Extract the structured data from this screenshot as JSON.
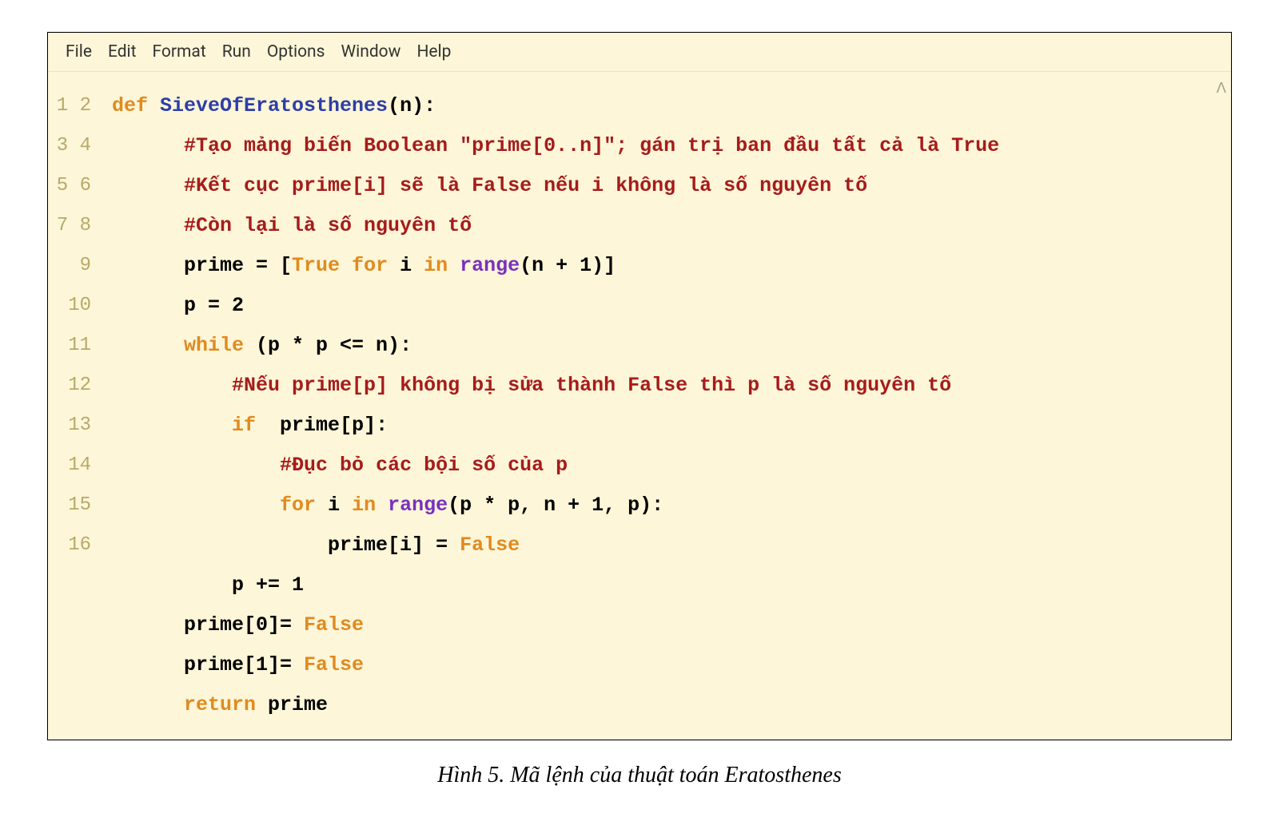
{
  "menu": [
    "File",
    "Edit",
    "Format",
    "Run",
    "Options",
    "Window",
    "Help"
  ],
  "line_numbers": [
    "1",
    "2",
    "3",
    "4",
    "5",
    "6",
    "7",
    "8",
    "9",
    "10",
    "11",
    "12",
    "13",
    "14",
    "15",
    "16"
  ],
  "code_lines": [
    [
      [
        "kw",
        "def "
      ],
      [
        "fn",
        "SieveOfEratosthenes"
      ],
      [
        "txt",
        "(n):"
      ]
    ],
    [
      [
        "txt",
        "      "
      ],
      [
        "cm",
        "#Tạo mảng biến Boolean \"prime[0..n]\"; gán trị ban đầu tất cả là True"
      ]
    ],
    [
      [
        "txt",
        "      "
      ],
      [
        "cm",
        "#Kết cục prime[i] sẽ là False nếu i không là số nguyên tố"
      ]
    ],
    [
      [
        "txt",
        "      "
      ],
      [
        "cm",
        "#Còn lại là số nguyên tố"
      ]
    ],
    [
      [
        "txt",
        "      prime = ["
      ],
      [
        "bl",
        "True"
      ],
      [
        "txt",
        " "
      ],
      [
        "kw",
        "for"
      ],
      [
        "txt",
        " i "
      ],
      [
        "kw",
        "in"
      ],
      [
        "txt",
        " "
      ],
      [
        "bi",
        "range"
      ],
      [
        "txt",
        "(n + 1)]"
      ]
    ],
    [
      [
        "txt",
        "      p = 2"
      ]
    ],
    [
      [
        "txt",
        "      "
      ],
      [
        "kw",
        "while"
      ],
      [
        "txt",
        " (p * p <= n):"
      ]
    ],
    [
      [
        "txt",
        "          "
      ],
      [
        "cm",
        "#Nếu prime[p] không bị sửa thành False thì p là số nguyên tố"
      ]
    ],
    [
      [
        "txt",
        "          "
      ],
      [
        "kw",
        "if"
      ],
      [
        "txt",
        "  prime[p]:"
      ]
    ],
    [
      [
        "txt",
        "              "
      ],
      [
        "cm",
        "#Đục bỏ các bội số của p"
      ]
    ],
    [
      [
        "txt",
        "              "
      ],
      [
        "kw",
        "for"
      ],
      [
        "txt",
        " i "
      ],
      [
        "kw",
        "in"
      ],
      [
        "txt",
        " "
      ],
      [
        "bi",
        "range"
      ],
      [
        "txt",
        "(p * p, n + 1, p):"
      ]
    ],
    [
      [
        "txt",
        "                  prime[i] = "
      ],
      [
        "bl",
        "False"
      ]
    ],
    [
      [
        "txt",
        "          p += 1"
      ]
    ],
    [
      [
        "txt",
        "      prime[0]= "
      ],
      [
        "bl",
        "False"
      ]
    ],
    [
      [
        "txt",
        "      prime[1]= "
      ],
      [
        "bl",
        "False"
      ]
    ],
    [
      [
        "txt",
        "      "
      ],
      [
        "kw",
        "return"
      ],
      [
        "txt",
        " prime"
      ]
    ]
  ],
  "scroll_hint": "ᐱ",
  "caption": "Hình 5. Mã lệnh của thuật toán Eratosthenes"
}
